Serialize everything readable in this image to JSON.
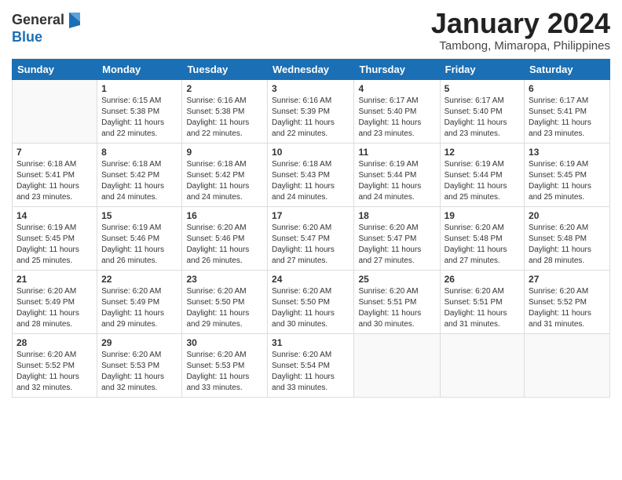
{
  "logo": {
    "general": "General",
    "blue": "Blue"
  },
  "title": "January 2024",
  "subtitle": "Tambong, Mimaropa, Philippines",
  "days_of_week": [
    "Sunday",
    "Monday",
    "Tuesday",
    "Wednesday",
    "Thursday",
    "Friday",
    "Saturday"
  ],
  "weeks": [
    [
      {
        "day": "",
        "info": ""
      },
      {
        "day": "1",
        "info": "Sunrise: 6:15 AM\nSunset: 5:38 PM\nDaylight: 11 hours\nand 22 minutes."
      },
      {
        "day": "2",
        "info": "Sunrise: 6:16 AM\nSunset: 5:38 PM\nDaylight: 11 hours\nand 22 minutes."
      },
      {
        "day": "3",
        "info": "Sunrise: 6:16 AM\nSunset: 5:39 PM\nDaylight: 11 hours\nand 22 minutes."
      },
      {
        "day": "4",
        "info": "Sunrise: 6:17 AM\nSunset: 5:40 PM\nDaylight: 11 hours\nand 23 minutes."
      },
      {
        "day": "5",
        "info": "Sunrise: 6:17 AM\nSunset: 5:40 PM\nDaylight: 11 hours\nand 23 minutes."
      },
      {
        "day": "6",
        "info": "Sunrise: 6:17 AM\nSunset: 5:41 PM\nDaylight: 11 hours\nand 23 minutes."
      }
    ],
    [
      {
        "day": "7",
        "info": "Sunrise: 6:18 AM\nSunset: 5:41 PM\nDaylight: 11 hours\nand 23 minutes."
      },
      {
        "day": "8",
        "info": "Sunrise: 6:18 AM\nSunset: 5:42 PM\nDaylight: 11 hours\nand 24 minutes."
      },
      {
        "day": "9",
        "info": "Sunrise: 6:18 AM\nSunset: 5:42 PM\nDaylight: 11 hours\nand 24 minutes."
      },
      {
        "day": "10",
        "info": "Sunrise: 6:18 AM\nSunset: 5:43 PM\nDaylight: 11 hours\nand 24 minutes."
      },
      {
        "day": "11",
        "info": "Sunrise: 6:19 AM\nSunset: 5:44 PM\nDaylight: 11 hours\nand 24 minutes."
      },
      {
        "day": "12",
        "info": "Sunrise: 6:19 AM\nSunset: 5:44 PM\nDaylight: 11 hours\nand 25 minutes."
      },
      {
        "day": "13",
        "info": "Sunrise: 6:19 AM\nSunset: 5:45 PM\nDaylight: 11 hours\nand 25 minutes."
      }
    ],
    [
      {
        "day": "14",
        "info": "Sunrise: 6:19 AM\nSunset: 5:45 PM\nDaylight: 11 hours\nand 25 minutes."
      },
      {
        "day": "15",
        "info": "Sunrise: 6:19 AM\nSunset: 5:46 PM\nDaylight: 11 hours\nand 26 minutes."
      },
      {
        "day": "16",
        "info": "Sunrise: 6:20 AM\nSunset: 5:46 PM\nDaylight: 11 hours\nand 26 minutes."
      },
      {
        "day": "17",
        "info": "Sunrise: 6:20 AM\nSunset: 5:47 PM\nDaylight: 11 hours\nand 27 minutes."
      },
      {
        "day": "18",
        "info": "Sunrise: 6:20 AM\nSunset: 5:47 PM\nDaylight: 11 hours\nand 27 minutes."
      },
      {
        "day": "19",
        "info": "Sunrise: 6:20 AM\nSunset: 5:48 PM\nDaylight: 11 hours\nand 27 minutes."
      },
      {
        "day": "20",
        "info": "Sunrise: 6:20 AM\nSunset: 5:48 PM\nDaylight: 11 hours\nand 28 minutes."
      }
    ],
    [
      {
        "day": "21",
        "info": "Sunrise: 6:20 AM\nSunset: 5:49 PM\nDaylight: 11 hours\nand 28 minutes."
      },
      {
        "day": "22",
        "info": "Sunrise: 6:20 AM\nSunset: 5:49 PM\nDaylight: 11 hours\nand 29 minutes."
      },
      {
        "day": "23",
        "info": "Sunrise: 6:20 AM\nSunset: 5:50 PM\nDaylight: 11 hours\nand 29 minutes."
      },
      {
        "day": "24",
        "info": "Sunrise: 6:20 AM\nSunset: 5:50 PM\nDaylight: 11 hours\nand 30 minutes."
      },
      {
        "day": "25",
        "info": "Sunrise: 6:20 AM\nSunset: 5:51 PM\nDaylight: 11 hours\nand 30 minutes."
      },
      {
        "day": "26",
        "info": "Sunrise: 6:20 AM\nSunset: 5:51 PM\nDaylight: 11 hours\nand 31 minutes."
      },
      {
        "day": "27",
        "info": "Sunrise: 6:20 AM\nSunset: 5:52 PM\nDaylight: 11 hours\nand 31 minutes."
      }
    ],
    [
      {
        "day": "28",
        "info": "Sunrise: 6:20 AM\nSunset: 5:52 PM\nDaylight: 11 hours\nand 32 minutes."
      },
      {
        "day": "29",
        "info": "Sunrise: 6:20 AM\nSunset: 5:53 PM\nDaylight: 11 hours\nand 32 minutes."
      },
      {
        "day": "30",
        "info": "Sunrise: 6:20 AM\nSunset: 5:53 PM\nDaylight: 11 hours\nand 33 minutes."
      },
      {
        "day": "31",
        "info": "Sunrise: 6:20 AM\nSunset: 5:54 PM\nDaylight: 11 hours\nand 33 minutes."
      },
      {
        "day": "",
        "info": ""
      },
      {
        "day": "",
        "info": ""
      },
      {
        "day": "",
        "info": ""
      }
    ]
  ]
}
